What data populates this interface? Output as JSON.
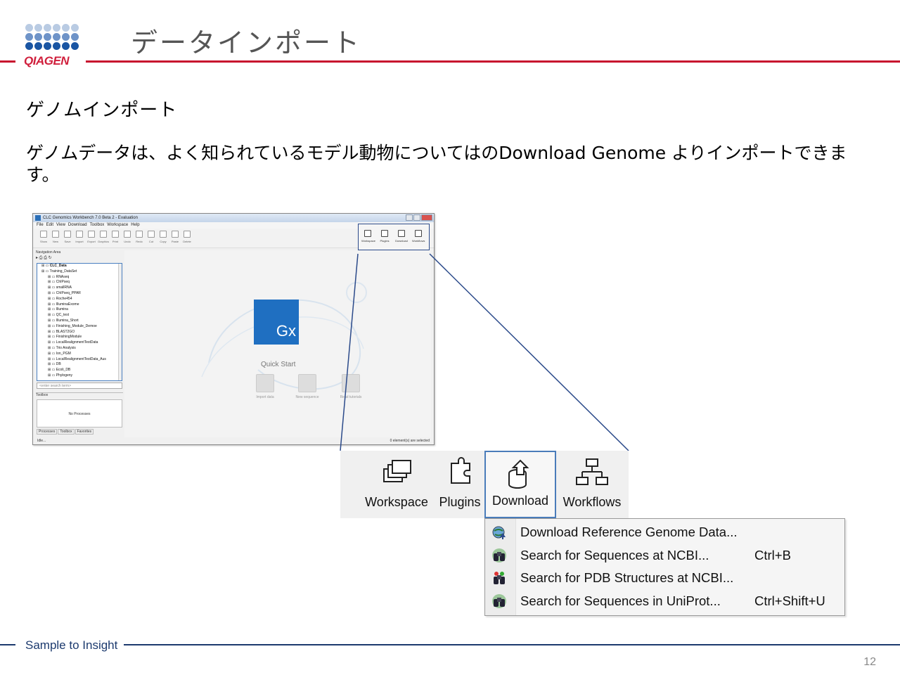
{
  "header": {
    "logo_text": "QIAGEN",
    "title": "データインポート",
    "brand_color": "#c8102e"
  },
  "subtitle": "ゲノムインポート",
  "body": "ゲノムデータは、よく知られているモデル動物についてはのDownload Genome よりインポートできます。",
  "app": {
    "window_title": "CLC Genomics Workbench 7.0 Beta 2 - Evaluation",
    "menu": [
      "File",
      "Edit",
      "View",
      "Download",
      "Toolbox",
      "Workspace",
      "Help"
    ],
    "toolbar": [
      "Show",
      "New",
      "Save",
      "Import",
      "Export",
      "Graphics",
      "Print",
      "Undo",
      "Redo",
      "Cut",
      "Copy",
      "Paste",
      "Delete"
    ],
    "toolbar_right": [
      "Workspace",
      "Plugins",
      "Download",
      "Workflows"
    ],
    "nav_label": "Navigation Area",
    "tree": [
      {
        "label": "CLC_Data",
        "level": 1
      },
      {
        "label": "Training_DataSet",
        "level": 1
      },
      {
        "label": "RNAseq",
        "level": 2
      },
      {
        "label": "ChIPseq",
        "level": 2
      },
      {
        "label": "smallRNA",
        "level": 2
      },
      {
        "label": "ChIPseq_PPAR",
        "level": 2
      },
      {
        "label": "Roche454",
        "level": 2
      },
      {
        "label": "IlluminaExome",
        "level": 2
      },
      {
        "label": "Illumina",
        "level": 2
      },
      {
        "label": "QC_test",
        "level": 2
      },
      {
        "label": "Illumina_Short",
        "level": 2
      },
      {
        "label": "Finishing_Module_Demoe",
        "level": 2
      },
      {
        "label": "BLAST2GO",
        "level": 2
      },
      {
        "label": "FinishingModule",
        "level": 2
      },
      {
        "label": "LocalRealignmentTestData",
        "level": 2
      },
      {
        "label": "Trio Analysis",
        "level": 2
      },
      {
        "label": "Ion_PGM",
        "level": 2
      },
      {
        "label": "LocalRealignmentTestData_Aus",
        "level": 2
      },
      {
        "label": "DB",
        "level": 2
      },
      {
        "label": "Ecoli_DB",
        "level": 2
      },
      {
        "label": "Phylogeny",
        "level": 2
      }
    ],
    "search_placeholder": "<enter search term>",
    "toolbox_label": "Toolbox",
    "no_processes": "No Processes",
    "process_tabs": [
      "Processes",
      "Toolbox",
      "Favorites"
    ],
    "status_left": "Idle...",
    "status_right": "0 element(s) are selected",
    "logo_text": "Gx",
    "quick_start": "Quick Start",
    "quick_items": [
      "Import data",
      "New sequence",
      "Read tutorials"
    ]
  },
  "zoom_buttons": [
    {
      "label": "Workspace",
      "icon": "workspace-icon",
      "active": false
    },
    {
      "label": "Plugins",
      "icon": "plugins-icon",
      "active": false
    },
    {
      "label": "Download",
      "icon": "download-icon",
      "active": true
    },
    {
      "label": "Workflows",
      "icon": "workflows-icon",
      "active": false
    }
  ],
  "download_menu": [
    {
      "label": "Download Reference Genome Data...",
      "shortcut": "",
      "icon": "globe-download-icon"
    },
    {
      "label": "Search for Sequences at NCBI...",
      "shortcut": "Ctrl+B",
      "icon": "binoculars-icon"
    },
    {
      "label": "Search for PDB Structures at NCBI...",
      "shortcut": "",
      "icon": "binoculars-molecule-icon"
    },
    {
      "label": "Search for Sequences in UniProt...",
      "shortcut": "Ctrl+Shift+U",
      "icon": "binoculars-icon"
    }
  ],
  "footer": {
    "text": "Sample to Insight",
    "page_number": "12"
  }
}
